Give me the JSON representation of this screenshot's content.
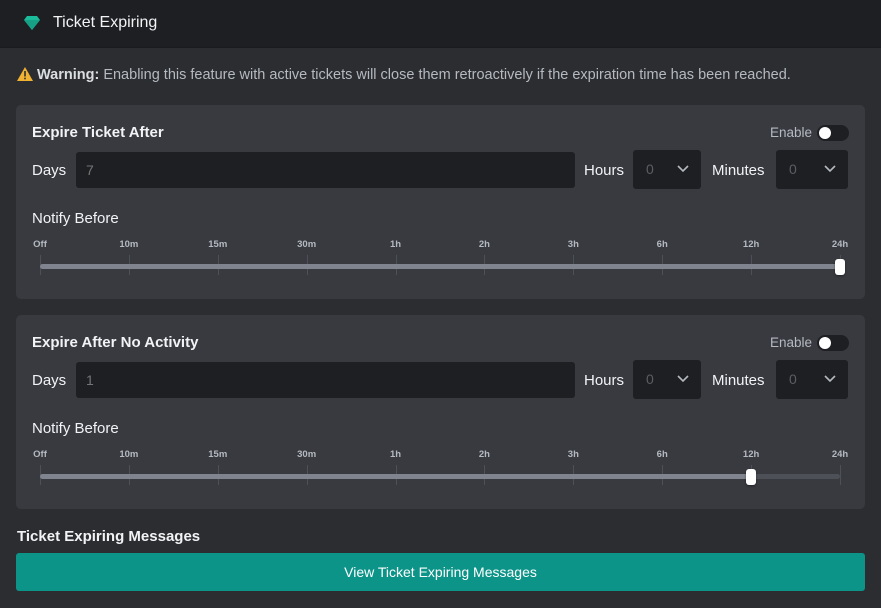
{
  "header": {
    "title": "Ticket Expiring",
    "icon": "gem-icon",
    "accent": "#1abc9c"
  },
  "warning": {
    "strong": "Warning:",
    "text": " Enabling this feature with active tickets will close them retroactively if the expiration time has been reached.",
    "icon": "warning-icon",
    "icon_color": "#f0b232"
  },
  "sections": [
    {
      "title": "Expire Ticket After",
      "enable_label": "Enable",
      "enabled": false,
      "days_label": "Days",
      "days_placeholder": "7",
      "hours_label": "Hours",
      "hours_value": "0",
      "minutes_label": "Minutes",
      "minutes_value": "0",
      "notify_label": "Notify Before",
      "selected_index": 9
    },
    {
      "title": "Expire After No Activity",
      "enable_label": "Enable",
      "enabled": false,
      "days_label": "Days",
      "days_placeholder": "1",
      "hours_label": "Hours",
      "hours_value": "0",
      "minutes_label": "Minutes",
      "minutes_value": "0",
      "notify_label": "Notify Before",
      "selected_index": 8
    }
  ],
  "notify_ticks": [
    "Off",
    "10m",
    "15m",
    "30m",
    "1h",
    "2h",
    "3h",
    "6h",
    "12h",
    "24h"
  ],
  "messages": {
    "title": "Ticket Expiring Messages",
    "button_label": "View Ticket Expiring Messages",
    "button_color": "#0d9488"
  }
}
